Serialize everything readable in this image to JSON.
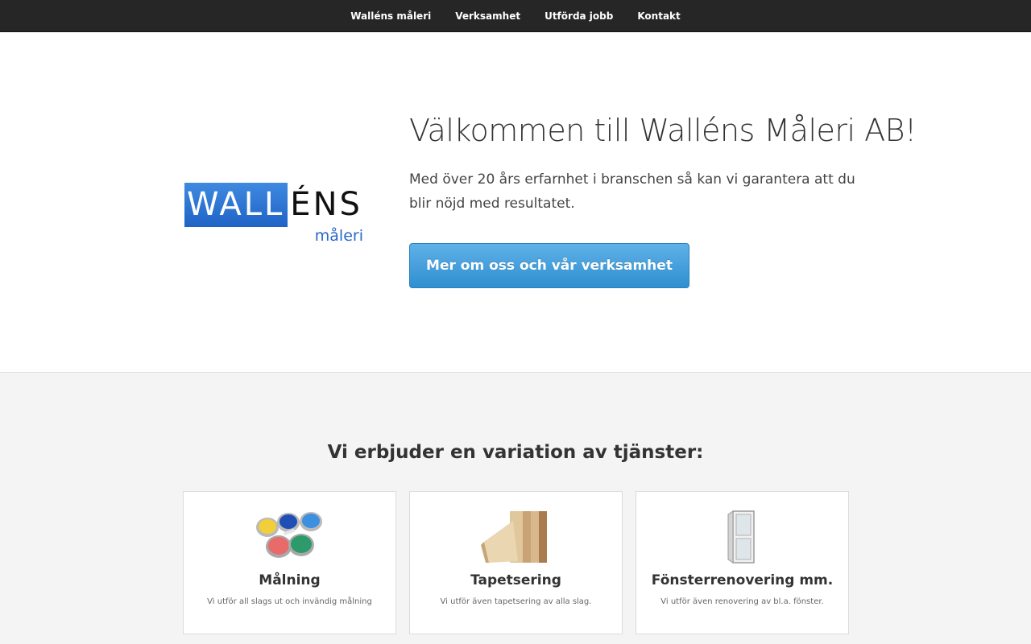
{
  "nav": {
    "items": [
      {
        "label": "Walléns måleri"
      },
      {
        "label": "Verksamhet"
      },
      {
        "label": "Utförda jobb"
      },
      {
        "label": "Kontakt"
      }
    ]
  },
  "logo": {
    "word_blue": "WALL",
    "word_black": "ÉNS",
    "sub": "måleri"
  },
  "hero": {
    "title": "Välkommen till Walléns Måleri AB!",
    "text": "Med över 20 års erfarnhet i branschen så kan vi garantera att du blir nöjd med resultatet.",
    "button_label": "Mer om oss och vår verksamhet"
  },
  "services": {
    "title": "Vi erbjuder en variation av tjänster:",
    "cards": [
      {
        "title": "Målning",
        "desc": "Vi utför all slags ut och invändig målning",
        "icon": "paint-cans-icon"
      },
      {
        "title": "Tapetsering",
        "desc": "Vi utför även tapetsering av alla slag.",
        "icon": "wallpaper-rolls-icon"
      },
      {
        "title": "Fönsterrenovering mm.",
        "desc": "Vi utför även renovering av bl.a. fönster.",
        "icon": "window-icon"
      }
    ]
  },
  "colors": {
    "nav_bg": "#262626",
    "accent_blue": "#2f8fd0",
    "logo_blue": "#2a68c8",
    "services_bg": "#f4f4f4"
  }
}
